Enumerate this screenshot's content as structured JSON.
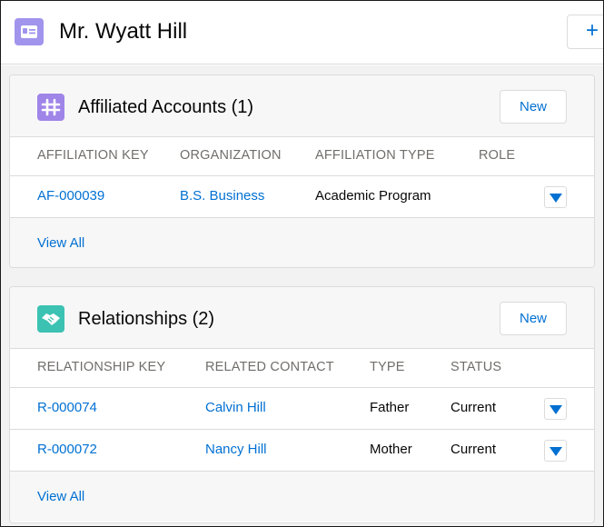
{
  "header": {
    "title": "Mr. Wyatt Hill",
    "icon": "contact-card-icon",
    "action_symbol": "+"
  },
  "affiliations": {
    "title": "Affiliated Accounts (1)",
    "icon": "hash-icon",
    "new_label": "New",
    "columns": [
      "AFFILIATION KEY",
      "ORGANIZATION",
      "AFFILIATION TYPE",
      "ROLE"
    ],
    "rows": [
      {
        "key": "AF-000039",
        "organization": "B.S. Business",
        "type": "Academic Program",
        "role": ""
      }
    ],
    "view_all": "View All"
  },
  "relationships": {
    "title": "Relationships (2)",
    "icon": "handshake-icon",
    "new_label": "New",
    "columns": [
      "RELATIONSHIP KEY",
      "RELATED CONTACT",
      "TYPE",
      "STATUS"
    ],
    "rows": [
      {
        "key": "R-000074",
        "contact": "Calvin Hill",
        "type": "Father",
        "status": "Current"
      },
      {
        "key": "R-000072",
        "contact": "Nancy Hill",
        "type": "Mother",
        "status": "Current"
      }
    ],
    "view_all": "View All"
  },
  "colors": {
    "link": "#0070d2",
    "contact_icon_bg": "#a094ed",
    "affiliation_icon_bg": "#9f85e8",
    "relationship_icon_bg": "#3cc2b3",
    "border": "#dddbda",
    "header_text": "#706e6b"
  }
}
